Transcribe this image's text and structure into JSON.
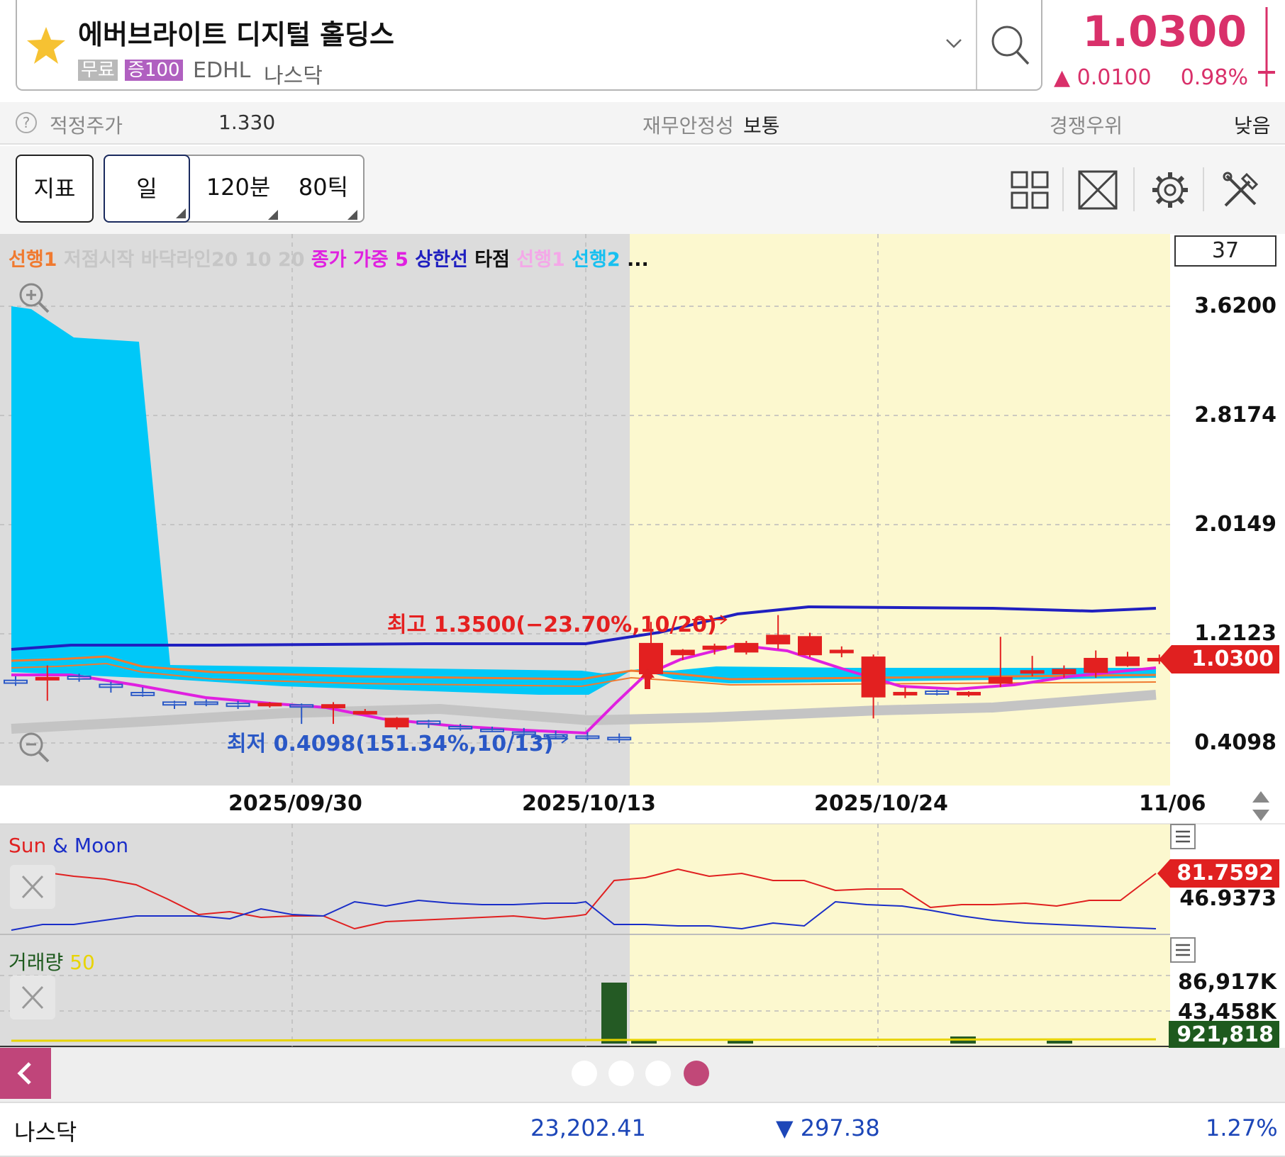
{
  "header": {
    "stock_name": "에버브라이트 디지털 홀딩스",
    "tag_free": "무료",
    "tag_margin": "증100",
    "ticker": "EDHL",
    "market": "나스닥",
    "price": "1.0300",
    "change_abs": "▲ 0.0100",
    "change_pct": "0.98%",
    "accent_color": "#d9306a"
  },
  "info_bar": {
    "fair_price_label": "적정주가",
    "fair_price_value": "1.330",
    "financial_stability_label": "재무안정성",
    "financial_stability_value": "보통",
    "competitive_label": "경쟁우위",
    "competitive_value": "낮음"
  },
  "toolbar": {
    "indicator_label": "지표",
    "period_day": "일",
    "period_120min": "120분",
    "period_80tick": "80틱",
    "icons": [
      "layout-icon",
      "expand-icon",
      "settings-icon",
      "tools-icon"
    ]
  },
  "chart": {
    "legend": [
      {
        "text": "선행1",
        "color": "#f07a30"
      },
      {
        "text": "저점시작 바닥라인20 10 20",
        "color": "#c6c6c6"
      },
      {
        "text": "종가 가중 5",
        "color": "#e020e0"
      },
      {
        "text": "상한선",
        "color": "#2020c0"
      },
      {
        "text": "타점",
        "color": "#111111"
      },
      {
        "text": "선행1",
        "color": "#f4a8e8"
      },
      {
        "text": "선행2",
        "color": "#18c0f0"
      },
      {
        "text": "...",
        "color": "#111111"
      }
    ],
    "visible_count": "37",
    "y_labels": [
      "3.6200",
      "2.8174",
      "2.0149",
      "1.2123",
      "0.4098"
    ],
    "x_labels": [
      "2025/09/30",
      "2025/10/13",
      "2025/10/24",
      "11/06"
    ],
    "current_price_tag": "1.0300",
    "high_annotation": "최고 1.3500(−23.70%,10/20)",
    "low_annotation": "최저 0.4098(151.34%,10/13)",
    "up_color": "#e32020",
    "down_color": "#2a58c6"
  },
  "chart_data": {
    "type": "candlestick",
    "ylim": [
      0.4098,
      3.62
    ],
    "y_ticks": [
      3.62,
      2.8174,
      2.0149,
      1.2123,
      0.4098
    ],
    "candles": [
      {
        "o": 0.87,
        "h": 0.9,
        "l": 0.83,
        "c": 0.85
      },
      {
        "o": 0.88,
        "h": 0.98,
        "l": 0.72,
        "c": 0.89
      },
      {
        "o": 0.9,
        "h": 0.92,
        "l": 0.86,
        "c": 0.88
      },
      {
        "o": 0.84,
        "h": 0.86,
        "l": 0.78,
        "c": 0.82
      },
      {
        "o": 0.78,
        "h": 0.82,
        "l": 0.75,
        "c": 0.76
      },
      {
        "o": 0.71,
        "h": 0.72,
        "l": 0.66,
        "c": 0.69
      },
      {
        "o": 0.71,
        "h": 0.73,
        "l": 0.68,
        "c": 0.7
      },
      {
        "o": 0.7,
        "h": 0.72,
        "l": 0.66,
        "c": 0.68
      },
      {
        "o": 0.69,
        "h": 0.71,
        "l": 0.67,
        "c": 0.7
      },
      {
        "o": 0.69,
        "h": 0.7,
        "l": 0.55,
        "c": 0.68
      },
      {
        "o": 0.67,
        "h": 0.71,
        "l": 0.55,
        "c": 0.69
      },
      {
        "o": 0.64,
        "h": 0.66,
        "l": 0.63,
        "c": 0.64
      },
      {
        "o": 0.53,
        "h": 0.6,
        "l": 0.51,
        "c": 0.59
      },
      {
        "o": 0.57,
        "h": 0.58,
        "l": 0.52,
        "c": 0.55
      },
      {
        "o": 0.53,
        "h": 0.55,
        "l": 0.5,
        "c": 0.52
      },
      {
        "o": 0.51,
        "h": 0.53,
        "l": 0.49,
        "c": 0.5
      },
      {
        "o": 0.49,
        "h": 0.52,
        "l": 0.46,
        "c": 0.48
      },
      {
        "o": 0.47,
        "h": 0.5,
        "l": 0.44,
        "c": 0.46
      },
      {
        "o": 0.46,
        "h": 0.49,
        "l": 0.43,
        "c": 0.45
      },
      {
        "o": 0.45,
        "h": 0.48,
        "l": 0.41,
        "c": 0.44
      },
      {
        "o": 0.92,
        "h": 1.3,
        "l": 0.88,
        "c": 1.14
      },
      {
        "o": 1.06,
        "h": 1.1,
        "l": 1.02,
        "c": 1.09
      },
      {
        "o": 1.1,
        "h": 1.14,
        "l": 1.06,
        "c": 1.12
      },
      {
        "o": 1.08,
        "h": 1.16,
        "l": 1.06,
        "c": 1.14
      },
      {
        "o": 1.14,
        "h": 1.35,
        "l": 1.1,
        "c": 1.2
      },
      {
        "o": 1.06,
        "h": 1.22,
        "l": 1.04,
        "c": 1.19
      },
      {
        "o": 1.08,
        "h": 1.12,
        "l": 1.04,
        "c": 1.09
      },
      {
        "o": 0.75,
        "h": 1.06,
        "l": 0.59,
        "c": 1.04
      },
      {
        "o": 0.77,
        "h": 0.82,
        "l": 0.74,
        "c": 0.78
      },
      {
        "o": 0.79,
        "h": 0.8,
        "l": 0.76,
        "c": 0.77
      },
      {
        "o": 0.77,
        "h": 0.79,
        "l": 0.75,
        "c": 0.78
      },
      {
        "o": 0.85,
        "h": 1.19,
        "l": 0.82,
        "c": 0.89
      },
      {
        "o": 0.93,
        "h": 1.05,
        "l": 0.9,
        "c": 0.94
      },
      {
        "o": 0.92,
        "h": 0.98,
        "l": 0.89,
        "c": 0.95
      },
      {
        "o": 0.93,
        "h": 1.09,
        "l": 0.89,
        "c": 1.03
      },
      {
        "o": 0.98,
        "h": 1.08,
        "l": 0.97,
        "c": 1.04
      },
      {
        "o": 1.02,
        "h": 1.06,
        "l": 0.99,
        "c": 1.03
      }
    ]
  },
  "sunmoon": {
    "title_sun": "Sun",
    "title_amp": "&",
    "title_moon": "Moon",
    "sun_value": "81.7592",
    "moon_value": "46.9373",
    "sun_color": "#e02020",
    "moon_color": "#1a2ec8"
  },
  "volume": {
    "title": "거래량",
    "period": "50",
    "max_label": "86,917K",
    "mid_label": "43,458K",
    "last_value": "921,818",
    "bar_color": "#245a24",
    "ma_color": "#e8d400"
  },
  "pager": {
    "page_count": 4,
    "active_page": 4
  },
  "index_bar": {
    "name": "나스닥",
    "value": "23,202.41",
    "change": "▼ 297.38",
    "pct": "1.27%"
  }
}
